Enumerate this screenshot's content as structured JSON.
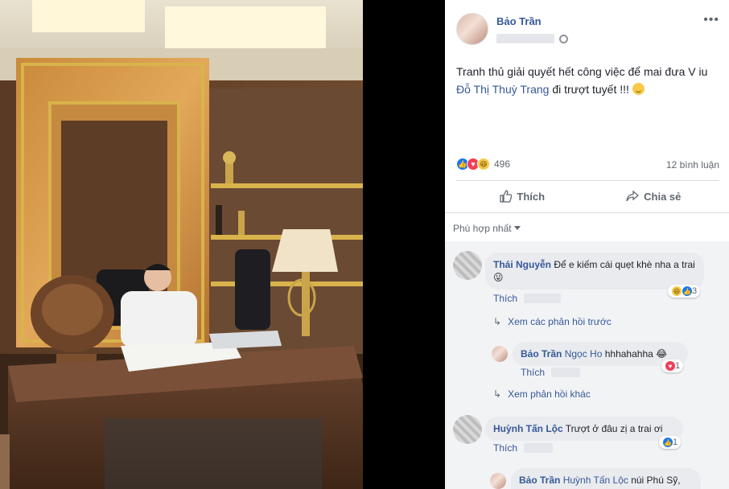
{
  "post": {
    "author": "Bảo Trần",
    "text_line1": "Tranh thủ giải quyết hết công việc để mai đưa V iu",
    "mention": "Đỗ Thị Thuỳ Trang",
    "text_line2_rest": " đi trượt tuyết !!! ",
    "reaction_count": "496",
    "comment_count": "12 bình luận",
    "like_label": "Thích",
    "share_label": "Chia sẻ",
    "sort_label": "Phù hợp nhất",
    "more_icon": "more-dots-icon",
    "privacy_icon": "globe-icon"
  },
  "comments": [
    {
      "author": "Thái Nguyễn",
      "text": "Để e kiếm cái quẹt khè nha a trai ",
      "like_label": "Thích",
      "reaction_count": "3",
      "reactions": [
        "haha",
        "like"
      ]
    },
    {
      "reply_link": "Xem các phản hồi trước"
    },
    {
      "author": "Bảo Trần",
      "mention": "Ngọc Ho",
      "text": " hhhahahha ",
      "like_label": "Thích",
      "reaction_count": "1",
      "reactions": [
        "love"
      ]
    },
    {
      "reply_link": "Xem phản hồi khác"
    },
    {
      "author": "Huỳnh Tấn Lộc",
      "text": "Trượt ở đâu zị a trai ơi",
      "like_label": "Thích",
      "reaction_count": "1",
      "reactions": [
        "like"
      ]
    },
    {
      "author": "Bảo Trần",
      "mention": "Huỳnh Tấn Lộc",
      "text": " núi Phú Sỹ,"
    }
  ]
}
